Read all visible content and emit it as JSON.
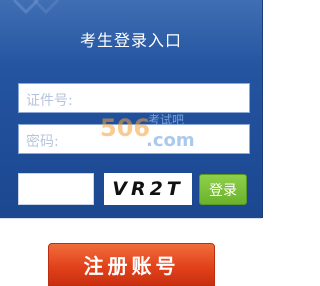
{
  "panel": {
    "title": "考生登录入口"
  },
  "form": {
    "id_label": "证件号:",
    "password_label": "密码:",
    "captcha_text": "VR2T",
    "login_label": "登录"
  },
  "register": {
    "label": "注册账号"
  },
  "watermark": {
    "number": "506",
    "brand_cn": "考试吧",
    "domain": ".com"
  },
  "colors": {
    "panel_blue": "#2454a0",
    "login_green": "#6cb22c",
    "register_red": "#e2421b"
  }
}
